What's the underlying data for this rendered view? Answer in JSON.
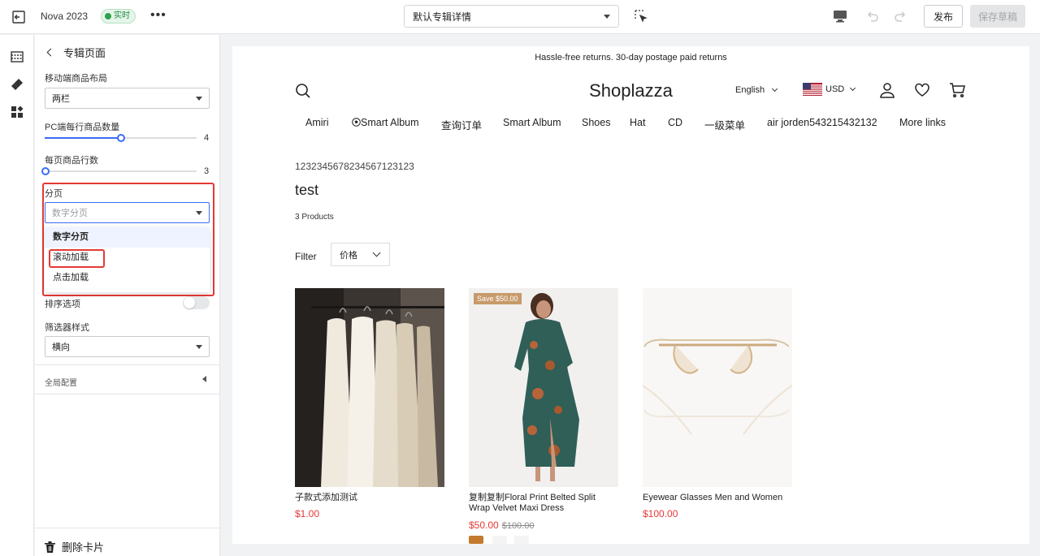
{
  "topbar": {
    "theme_name": "Nova 2023",
    "live_badge": "实时",
    "page_selector": "默认专辑详情",
    "publish_label": "发布",
    "save_draft_label": "保存草稿"
  },
  "panel": {
    "header_title": "专辑页面",
    "mobile_layout": {
      "label": "移动端商品布局",
      "value": "两栏"
    },
    "pc_per_row": {
      "label": "PC端每行商品数量",
      "value": "4",
      "fraction": 0.5
    },
    "rows_per_page": {
      "label": "每页商品行数",
      "value": "3",
      "fraction": 0.0
    },
    "pagination": {
      "label": "分页",
      "placeholder": "数字分页",
      "options": [
        "数字分页",
        "滚动加载",
        "点击加载"
      ]
    },
    "sort_option": {
      "label": "排序选项"
    },
    "filter_style": {
      "label": "筛选器样式",
      "value": "横向"
    },
    "global_config": "全局配置",
    "delete_card": "删除卡片"
  },
  "preview": {
    "announcement": "Hassle-free returns. 30-day postage paid returns",
    "logo": "Shoplazza",
    "language": "English",
    "currency": "USD",
    "nav": [
      "Amiri",
      "Smart Album",
      "查询订单",
      "Smart Album",
      "Shoes",
      "Hat",
      "CD",
      "一级菜单",
      "air jorden543215432132",
      "More links"
    ],
    "breadcrumb": "1232345678234567123123",
    "collection_title": "test",
    "product_count": "3 Products",
    "filter_label": "Filter",
    "price_filter": "价格",
    "products": [
      {
        "name": "子款式添加测试",
        "price": "$1.00"
      },
      {
        "name": "复制复制Floral Print Belted Split Wrap Velvet Maxi Dress",
        "price": "$50.00",
        "compare": "$100.00",
        "badge": "Save $50.00"
      },
      {
        "name": "Eyewear Glasses Men and Women",
        "price": "$100.00"
      }
    ]
  },
  "colors": {
    "accent": "#3b6cf4",
    "highlight": "#e53935",
    "price": "#e53935",
    "live_green": "#2ba24c"
  }
}
